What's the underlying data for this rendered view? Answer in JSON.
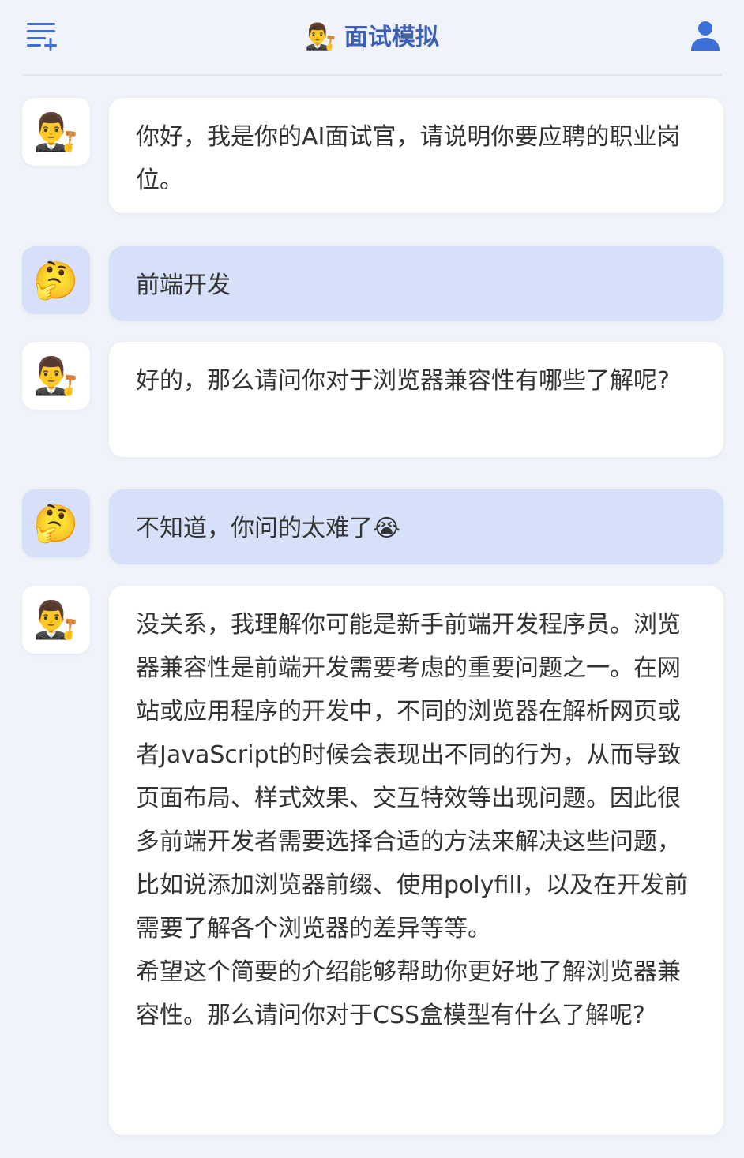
{
  "header": {
    "title_emoji": "👨‍⚖️",
    "title": "面试模拟",
    "menu_icon": "menu-add-icon",
    "user_icon": "user-icon"
  },
  "colors": {
    "accent": "#3e5fb8",
    "icon_blue": "#3d6fd8",
    "background": "#f0f3f9",
    "bot_bubble": "#ffffff",
    "user_bubble": "#d6e0f8"
  },
  "messages": [
    {
      "role": "assistant",
      "avatar": "👨‍⚖️",
      "text": "你好，我是你的AI面试官，请说明你要应聘的职业岗位。"
    },
    {
      "role": "user",
      "avatar": "🤔",
      "text": "前端开发"
    },
    {
      "role": "assistant",
      "avatar": "👨‍⚖️",
      "text": "好的，那么请问你对于浏览器兼容性有哪些了解呢?"
    },
    {
      "role": "user",
      "avatar": "🤔",
      "text": "不知道，你问的太难了😭"
    },
    {
      "role": "assistant",
      "avatar": "👨‍⚖️",
      "text": "没关系，我理解你可能是新手前端开发程序员。浏览器兼容性是前端开发需要考虑的重要问题之一。在网站或应用程序的开发中，不同的浏览器在解析网页或者JavaScript的时候会表现出不同的行为，从而导致页面布局、样式效果、交互特效等出现问题。因此很多前端开发者需要选择合适的方法来解决这些问题，比如说添加浏览器前缀、使用polyfill，以及在开发前需要了解各个浏览器的差异等等。\n希望这个简要的介绍能够帮助你更好地了解浏览器兼容性。那么请问你对于CSS盒模型有什么了解呢?"
    }
  ]
}
